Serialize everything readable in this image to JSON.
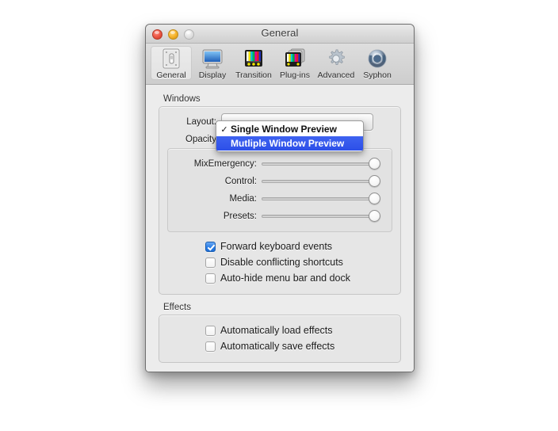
{
  "window": {
    "title": "General",
    "traffic_lights": [
      "close",
      "minimize",
      "zoom"
    ]
  },
  "toolbar": {
    "items": [
      {
        "label": "General",
        "icon": "switch-plate-icon",
        "selected": true
      },
      {
        "label": "Display",
        "icon": "monitor-icon",
        "selected": false
      },
      {
        "label": "Transition",
        "icon": "color-bars-icon",
        "selected": false
      },
      {
        "label": "Plug-ins",
        "icon": "color-bars-stack-icon",
        "selected": false
      },
      {
        "label": "Advanced",
        "icon": "gear-icon",
        "selected": false
      },
      {
        "label": "Syphon",
        "icon": "syphon-orb-icon",
        "selected": false
      }
    ]
  },
  "windows_section": {
    "label": "Windows",
    "layout_row_label": "Layout:",
    "opacity_row_label": "Opacity",
    "layout_selected_value": "Single Window Preview",
    "sliders": [
      {
        "label": "MixEmergency:",
        "value": 100
      },
      {
        "label": "Control:",
        "value": 100
      },
      {
        "label": "Media:",
        "value": 100
      },
      {
        "label": "Presets:",
        "value": 100
      }
    ],
    "checkboxes": [
      {
        "label": "Forward keyboard events",
        "checked": true
      },
      {
        "label": "Disable conflicting shortcuts",
        "checked": false
      },
      {
        "label": "Auto-hide menu bar and dock",
        "checked": false
      }
    ]
  },
  "effects_section": {
    "label": "Effects",
    "checkboxes": [
      {
        "label": "Automatically load effects",
        "checked": false
      },
      {
        "label": "Automatically save effects",
        "checked": false
      }
    ]
  },
  "popup_menu": {
    "open": true,
    "check_glyph": "✓",
    "items": [
      {
        "label": "Single Window Preview",
        "checked": true,
        "highlighted": false
      },
      {
        "label": "Mutliple Window Preview",
        "checked": false,
        "highlighted": true
      }
    ]
  },
  "colors": {
    "highlight_blue": "#2d4fe8",
    "checkbox_blue": "#2a7de6",
    "window_bg": "#ececec",
    "titlebar_top": "#e9e9e9"
  }
}
